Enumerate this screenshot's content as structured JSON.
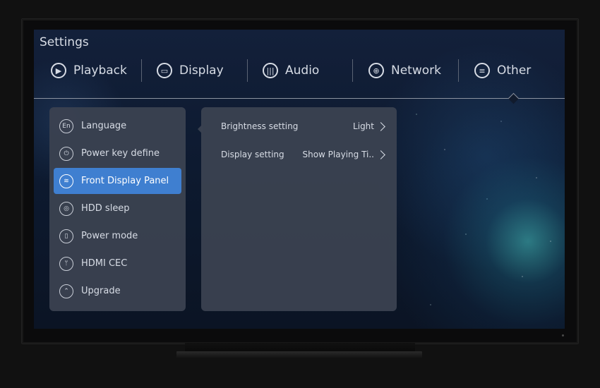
{
  "settings": {
    "title": "Settings"
  },
  "tabs": [
    {
      "label": "Playback",
      "icon": "play-icon"
    },
    {
      "label": "Display",
      "icon": "monitor-icon"
    },
    {
      "label": "Audio",
      "icon": "audio-wave-icon"
    },
    {
      "label": "Network",
      "icon": "globe-icon"
    },
    {
      "label": "Other",
      "icon": "list-icon"
    }
  ],
  "menu": {
    "items": [
      {
        "label": "Language",
        "icon": "language-icon",
        "glyph": "En"
      },
      {
        "label": "Power key define",
        "icon": "power-icon",
        "glyph": "⏻"
      },
      {
        "label": "Front Display Panel",
        "icon": "display-panel-icon",
        "glyph": "≋"
      },
      {
        "label": "HDD sleep",
        "icon": "hdd-icon",
        "glyph": "◎"
      },
      {
        "label": "Power mode",
        "icon": "power-mode-icon",
        "glyph": "▯"
      },
      {
        "label": "HDMI CEC",
        "icon": "hdmi-icon",
        "glyph": "ᛘ"
      },
      {
        "label": "Upgrade",
        "icon": "upgrade-icon",
        "glyph": "⌃"
      }
    ],
    "active_index": 2
  },
  "detail": {
    "rows": [
      {
        "label": "Brightness setting",
        "value": "Light"
      },
      {
        "label": "Display setting",
        "value": "Show Playing Ti.."
      }
    ]
  },
  "colors": {
    "accent": "#3f7fd0",
    "panel": "#3a4250",
    "text": "#d7dce5"
  }
}
